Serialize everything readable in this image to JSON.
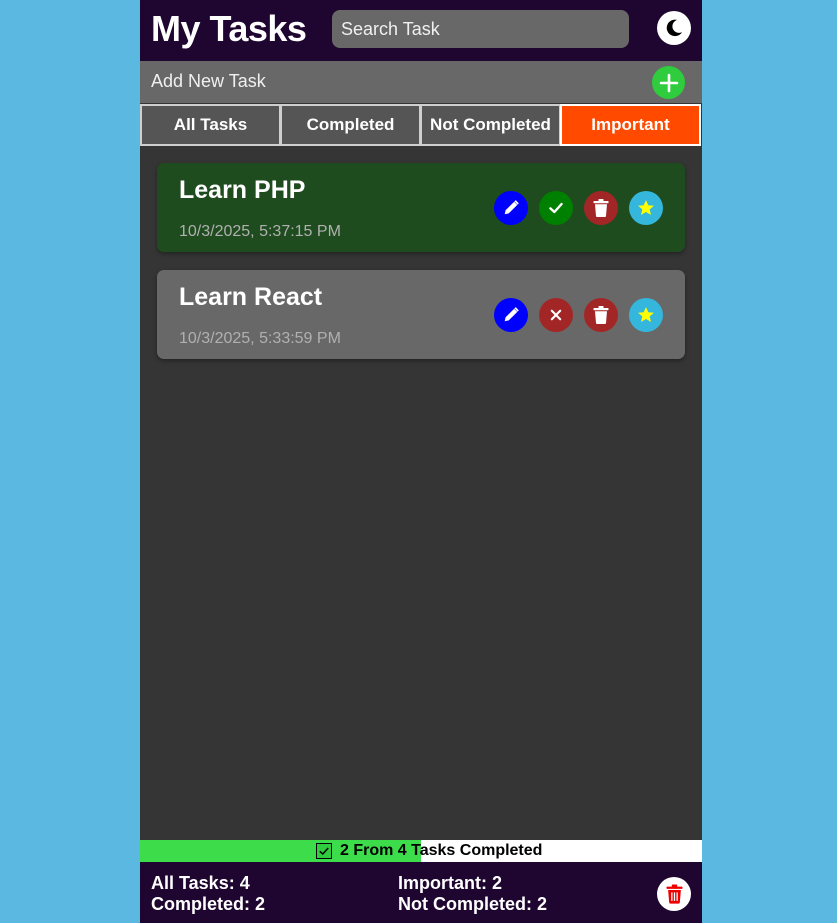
{
  "header": {
    "title": "My Tasks",
    "search_placeholder": "Search Task",
    "theme_icon": "moon-icon"
  },
  "add_task": {
    "label": "Add New Task",
    "icon": "plus-icon"
  },
  "tabs": [
    {
      "label": "All Tasks",
      "active": false
    },
    {
      "label": "Completed",
      "active": false
    },
    {
      "label": "Not Completed",
      "active": false
    },
    {
      "label": "Important",
      "active": true
    }
  ],
  "tasks": [
    {
      "title": "Learn PHP",
      "date": "10/3/2025, 5:37:15 PM",
      "completed": true,
      "important": true
    },
    {
      "title": "Learn React",
      "date": "10/3/2025, 5:33:59 PM",
      "completed": false,
      "important": true
    }
  ],
  "progress": {
    "text": "2 From 4 Tasks Completed",
    "fraction": 0.5
  },
  "stats": {
    "all": "All Tasks: 4",
    "completed": "Completed: 2",
    "important": "Important: 2",
    "not_completed": "Not Completed: 2"
  },
  "colors": {
    "header_bg": "#1f0630",
    "page_bg": "#5bb8e0",
    "active_tab": "#ff4a00",
    "completed_task": "#1f4c1f",
    "pending_task": "#686868",
    "progress_fill": "#3ddc4a"
  }
}
